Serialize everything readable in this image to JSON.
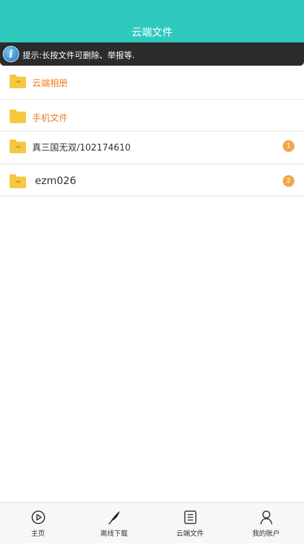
{
  "header": {
    "title": "云端文件"
  },
  "tip": {
    "icon": "info-icon",
    "text": "提示:长按文件可删除、举报等."
  },
  "folders": [
    {
      "label": "云端相册",
      "icon": "folder-cloud-album-icon"
    },
    {
      "label": "手机文件",
      "icon": "folder-phone-icon"
    }
  ],
  "files": [
    {
      "label": "真三国无双/102174610",
      "badge": "1",
      "icon": "folder-cloud-icon"
    },
    {
      "label": "ezm026",
      "badge": "2",
      "icon": "folder-cloud-icon"
    }
  ],
  "tabbar": {
    "items": [
      {
        "label": "主页",
        "icon": "play-circle-icon"
      },
      {
        "label": "离线下载",
        "icon": "feather-icon"
      },
      {
        "label": "云端文件",
        "icon": "list-doc-icon"
      },
      {
        "label": "我的账户",
        "icon": "user-icon"
      }
    ]
  },
  "colors": {
    "header_bg": "#2ec8bf",
    "accent_orange": "#f07b1f",
    "badge": "#f4a54a",
    "folder": "#f7c842"
  }
}
